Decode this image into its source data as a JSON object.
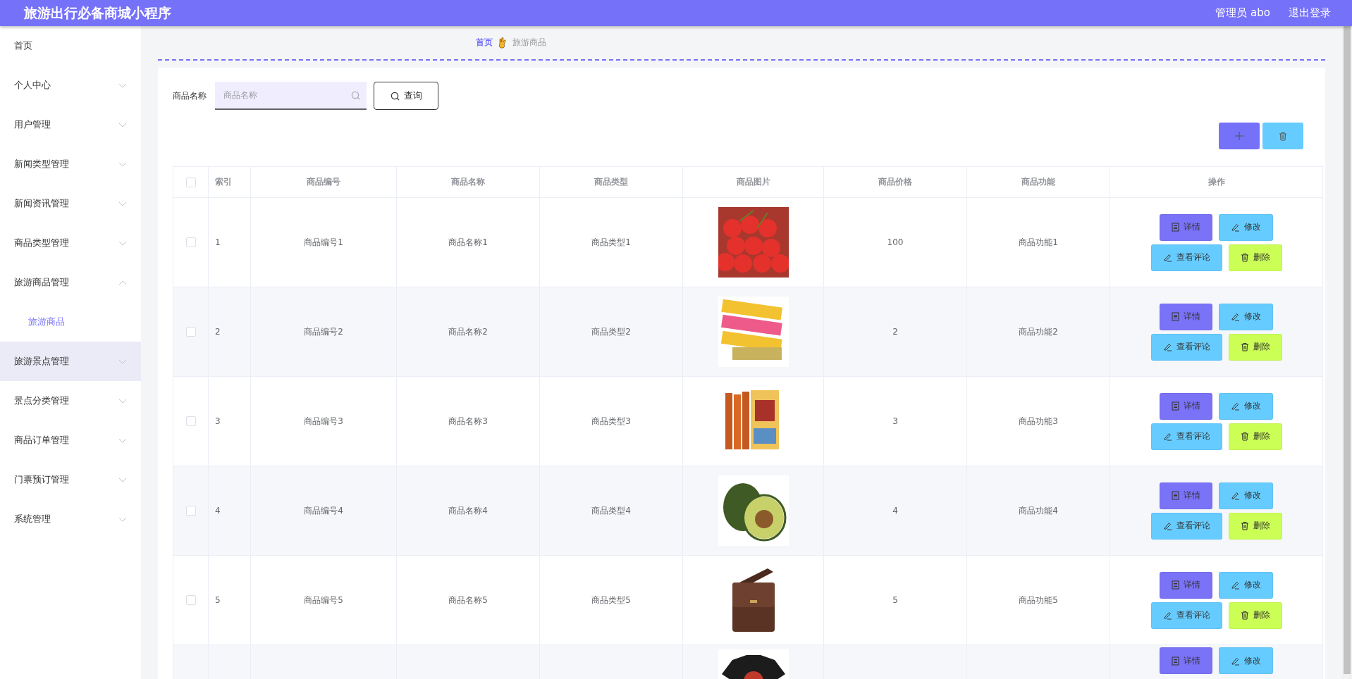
{
  "header": {
    "title": "旅游出行必备商城小程序",
    "user": "管理员 abo",
    "logout": "退出登录"
  },
  "sidebar": {
    "items": [
      {
        "label": "首页",
        "kind": "link"
      },
      {
        "label": "个人中心",
        "kind": "group",
        "expanded": false,
        "hovered": false
      },
      {
        "label": "用户管理",
        "kind": "group",
        "expanded": false,
        "hovered": false
      },
      {
        "label": "新闻类型管理",
        "kind": "group",
        "expanded": false,
        "hovered": false
      },
      {
        "label": "新闻资讯管理",
        "kind": "group",
        "expanded": false,
        "hovered": false
      },
      {
        "label": "商品类型管理",
        "kind": "group",
        "expanded": false,
        "hovered": false
      },
      {
        "label": "旅游商品管理",
        "kind": "group",
        "expanded": true,
        "hovered": false,
        "children": [
          {
            "label": "旅游商品",
            "selected": true
          }
        ]
      },
      {
        "label": "旅游景点管理",
        "kind": "group",
        "expanded": false,
        "hovered": true
      },
      {
        "label": "景点分类管理",
        "kind": "group",
        "expanded": false,
        "hovered": false
      },
      {
        "label": "商品订单管理",
        "kind": "group",
        "expanded": false,
        "hovered": false
      },
      {
        "label": "门票预订管理",
        "kind": "group",
        "expanded": false,
        "hovered": false
      },
      {
        "label": "系统管理",
        "kind": "group",
        "expanded": false,
        "hovered": false
      }
    ]
  },
  "breadcrumb": [
    "首页",
    "旅游商品"
  ],
  "search": {
    "label": "商品名称",
    "placeholder": "商品名称",
    "button": "查询"
  },
  "table": {
    "select_all": {
      "checked": false
    },
    "columns": [
      "索引",
      "商品编号",
      "商品名称",
      "商品类型",
      "商品图片",
      "商品价格",
      "商品功能",
      "操作"
    ],
    "rows": [
      {
        "checked": false,
        "index": "1",
        "code": "商品编号1",
        "name": "商品名称1",
        "type": "商品类型1",
        "price": "100",
        "function": "商品功能1",
        "actions": [
          {
            "kind": "detail",
            "label": "详情"
          },
          {
            "kind": "edit",
            "label": "修改"
          },
          {
            "kind": "comments",
            "label": "查看评论"
          },
          {
            "kind": "delete",
            "label": "删除"
          }
        ]
      },
      {
        "checked": false,
        "index": "2",
        "code": "商品编号2",
        "name": "商品名称2",
        "type": "商品类型2",
        "price": "2",
        "function": "商品功能2",
        "actions": [
          {
            "kind": "detail",
            "label": "详情"
          },
          {
            "kind": "edit",
            "label": "修改"
          },
          {
            "kind": "comments",
            "label": "查看评论"
          },
          {
            "kind": "delete",
            "label": "删除"
          }
        ]
      },
      {
        "checked": false,
        "index": "3",
        "code": "商品编号3",
        "name": "商品名称3",
        "type": "商品类型3",
        "price": "3",
        "function": "商品功能3",
        "actions": [
          {
            "kind": "detail",
            "label": "详情"
          },
          {
            "kind": "edit",
            "label": "修改"
          },
          {
            "kind": "comments",
            "label": "查看评论"
          },
          {
            "kind": "delete",
            "label": "删除"
          }
        ]
      },
      {
        "checked": false,
        "index": "4",
        "code": "商品编号4",
        "name": "商品名称4",
        "type": "商品类型4",
        "price": "4",
        "function": "商品功能4",
        "actions": [
          {
            "kind": "detail",
            "label": "详情"
          },
          {
            "kind": "edit",
            "label": "修改"
          },
          {
            "kind": "comments",
            "label": "查看评论"
          },
          {
            "kind": "delete",
            "label": "删除"
          }
        ]
      },
      {
        "checked": false,
        "index": "5",
        "code": "商品编号5",
        "name": "商品名称5",
        "type": "商品类型5",
        "price": "5",
        "function": "商品功能5",
        "actions": [
          {
            "kind": "detail",
            "label": "详情"
          },
          {
            "kind": "edit",
            "label": "修改"
          },
          {
            "kind": "comments",
            "label": "查看评论"
          },
          {
            "kind": "delete",
            "label": "删除"
          }
        ]
      },
      {
        "actions": [
          {
            "kind": "detail",
            "label": "详情"
          },
          {
            "kind": "edit",
            "label": "修改"
          }
        ]
      }
    ]
  }
}
